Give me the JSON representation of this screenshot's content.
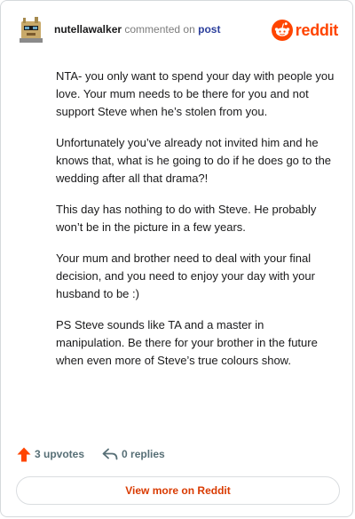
{
  "header": {
    "username": "nutellawalker",
    "action_text": "commented on",
    "link_text": "post",
    "brand_name": "reddit"
  },
  "comment": {
    "paragraphs": [
      "NTA- you only want to spend your day with people you love. Your mum needs to be there for you and not support Steve when he’s stolen from you.",
      "Unfortunately you’ve already not invited him and he knows that, what is he going to do if he does go to the wedding after all that drama?!",
      "This day has nothing to do with Steve. He probably won’t be in the picture in a few years.",
      "Your mum and brother need to deal with your final decision, and you need to enjoy your day with your husband to be :)",
      "PS Steve sounds like TA and a master in manipulation. Be there for your brother in the future when even more of Steve’s true colours show."
    ]
  },
  "footer": {
    "upvotes_label": "3 upvotes",
    "replies_label": "0 replies",
    "view_more_label": "View more on Reddit"
  },
  "colors": {
    "brand": "#ff4500",
    "link": "#2c3f9c",
    "view_more": "#d93a00",
    "upvote_icon": "#ff4500"
  },
  "icons": {
    "avatar": "user-avatar",
    "brand": "reddit-logo-icon",
    "upvote": "upvote-arrow-icon",
    "reply": "reply-icon"
  }
}
